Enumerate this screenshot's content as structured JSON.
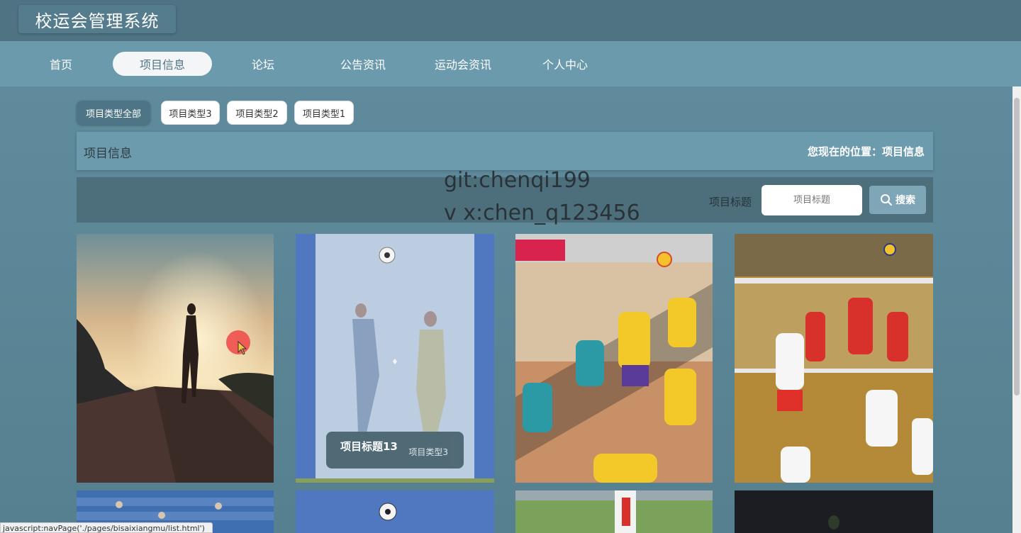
{
  "header": {
    "title": "校运会管理系统"
  },
  "nav": {
    "items": [
      {
        "label": "首页"
      },
      {
        "label": "项目信息"
      },
      {
        "label": "论坛"
      },
      {
        "label": "公告资讯"
      },
      {
        "label": "运动会资讯"
      },
      {
        "label": "个人中心"
      }
    ],
    "active": "项目信息"
  },
  "filters": {
    "items": [
      "项目类型全部",
      "项目类型3",
      "项目类型2",
      "项目类型1"
    ],
    "active": "项目类型全部"
  },
  "section": {
    "title": "项目信息",
    "breadcrumb": "您现在的位置：项目信息"
  },
  "search": {
    "label": "项目标题",
    "placeholder": "项目标题",
    "button_label": "搜索"
  },
  "watermark": {
    "line1": "git:chenqi199",
    "line2": "v x:chen_q123456"
  },
  "hover_card": {
    "title": "项目标题13",
    "type": "项目类型3"
  },
  "status_bar": {
    "text": "javascript:navPage('./pages/bisaixiangmu/list.html')"
  },
  "colors": {
    "header_bg": "#4f7382",
    "nav_bg": "#6b9aad",
    "active_pill": "#f4f5f6",
    "content_bg": "#5e8a9c",
    "search_bar_bg": "#4d6f7c"
  },
  "icons": {
    "search": "search-icon"
  }
}
